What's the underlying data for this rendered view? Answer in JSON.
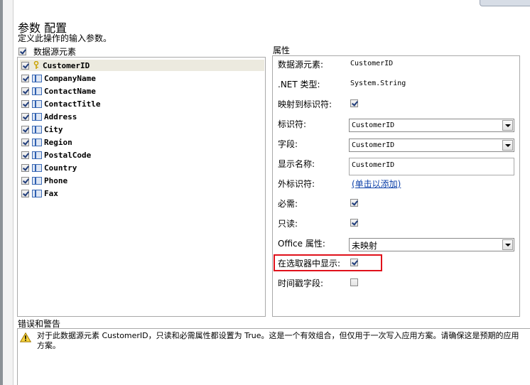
{
  "dialog": {
    "title": "参数 配置",
    "subtitle": "定义此操作的输入参数。"
  },
  "elements": {
    "select_all_label": "数据源元素",
    "select_all_checked": true,
    "items": [
      {
        "label": "CustomerID",
        "checked": true,
        "icon": "key-icon",
        "selected": true
      },
      {
        "label": "CompanyName",
        "checked": true,
        "icon": "field-icon"
      },
      {
        "label": "ContactName",
        "checked": true,
        "icon": "field-icon"
      },
      {
        "label": "ContactTitle",
        "checked": true,
        "icon": "field-icon"
      },
      {
        "label": "Address",
        "checked": true,
        "icon": "field-icon"
      },
      {
        "label": "City",
        "checked": true,
        "icon": "field-icon"
      },
      {
        "label": "Region",
        "checked": true,
        "icon": "field-icon"
      },
      {
        "label": "PostalCode",
        "checked": true,
        "icon": "field-icon"
      },
      {
        "label": "Country",
        "checked": true,
        "icon": "field-icon"
      },
      {
        "label": "Phone",
        "checked": true,
        "icon": "field-icon"
      },
      {
        "label": "Fax",
        "checked": true,
        "icon": "field-icon"
      }
    ]
  },
  "properties": {
    "header": "属性",
    "source_element_label": "数据源元素:",
    "source_element_value": "CustomerID",
    "net_type_label": ".NET 类型:",
    "net_type_value": "System.String",
    "map_identifier_label": "映射到标识符:",
    "map_identifier_checked": true,
    "identifier_label": "标识符:",
    "identifier_value": "CustomerID",
    "field_label": "字段:",
    "field_value": "CustomerID",
    "display_name_label": "显示名称:",
    "display_name_value": "CustomerID",
    "foreign_identifier_label": "外标识符:",
    "foreign_identifier_link": "(单击以添加)",
    "required_label": "必需:",
    "required_checked": true,
    "readonly_label": "只读:",
    "readonly_checked": true,
    "office_property_label": "Office 属性:",
    "office_property_value": "未映射",
    "show_in_picker_label": "在选取器中显示:",
    "show_in_picker_checked": true,
    "timestamp_label": "时间戳字段:",
    "timestamp_checked": false
  },
  "errors": {
    "header": "错误和警告",
    "message": "对于此数据源元素 CustomerID，只读和必需属性都设置为 True。这是一个有效组合，但仅用于一次写入应用方案。请确保这是预期的应用方案。"
  },
  "colors": {
    "highlight_border": "#e0111b",
    "link": "#0b3fa8",
    "selected_row": "#eceadf"
  }
}
